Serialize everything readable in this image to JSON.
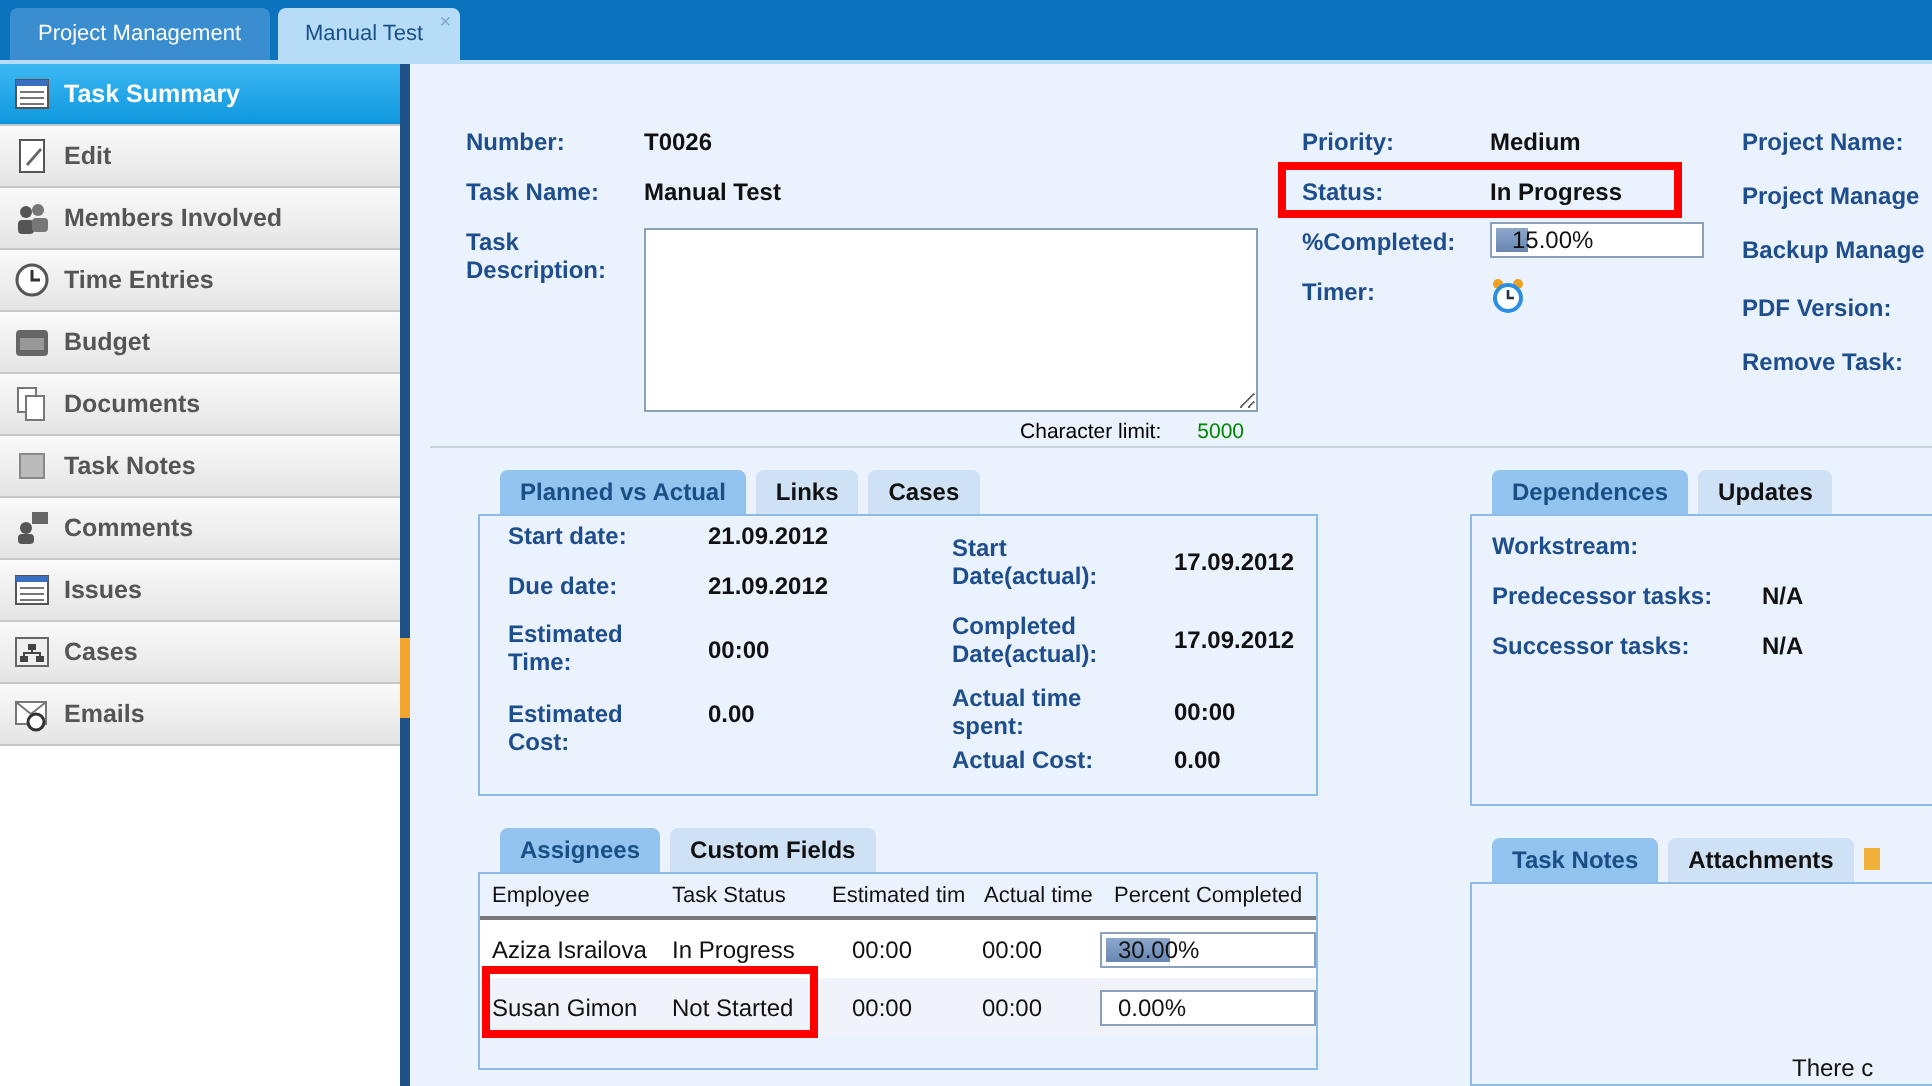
{
  "top_tabs": [
    {
      "label": "Project Management",
      "selected": false
    },
    {
      "label": "Manual Test",
      "selected": true,
      "close": "×"
    }
  ],
  "sidebar": {
    "items": [
      {
        "label": "Task Summary",
        "selected": true
      },
      {
        "label": "Edit",
        "selected": false
      },
      {
        "label": "Members Involved",
        "selected": false
      },
      {
        "label": "Time Entries",
        "selected": false
      },
      {
        "label": "Budget",
        "selected": false
      },
      {
        "label": "Documents",
        "selected": false
      },
      {
        "label": "Task Notes",
        "selected": false
      },
      {
        "label": "Comments",
        "selected": false
      },
      {
        "label": "Issues",
        "selected": false
      },
      {
        "label": "Cases",
        "selected": false
      },
      {
        "label": "Emails",
        "selected": false
      }
    ]
  },
  "summary": {
    "number_label": "Number:",
    "number": "T0026",
    "name_label": "Task Name:",
    "name": "Manual Test",
    "description_label": "Task Description:",
    "char_limit_label": "Character limit:",
    "char_limit": "5000",
    "priority_label": "Priority:",
    "priority": "Medium",
    "status_label": "Status:",
    "status": "In Progress",
    "status_highlighted": true,
    "completed_label": "%Completed:",
    "completed": {
      "value": "15.00%",
      "level": 0.15
    },
    "timer_label": "Timer:",
    "right_labels": [
      "Project Name:",
      "Project Manage",
      "Backup Manage",
      "PDF Version:",
      "Remove Task:"
    ]
  },
  "planned": {
    "tabs": [
      {
        "label": "Planned vs Actual",
        "selected": true
      },
      {
        "label": "Links",
        "selected": false
      },
      {
        "label": "Cases",
        "selected": false
      }
    ],
    "left": [
      {
        "label": "Start date:",
        "value": "21.09.2012"
      },
      {
        "label": "Due date:",
        "value": "21.09.2012"
      },
      {
        "label": "Estimated Time:",
        "value": "00:00"
      },
      {
        "label": "Estimated Cost:",
        "value": "0.00"
      }
    ],
    "right": [
      {
        "label": "Start Date(actual):",
        "value": "17.09.2012"
      },
      {
        "label": "Completed Date(actual):",
        "value": "17.09.2012"
      },
      {
        "label": "Actual time spent:",
        "value": "00:00"
      },
      {
        "label": "Actual Cost:",
        "value": "0.00"
      }
    ]
  },
  "dependences": {
    "tabs": [
      {
        "label": "Dependences",
        "selected": true
      },
      {
        "label": "Updates",
        "selected": false
      }
    ],
    "rows": [
      {
        "label": "Workstream:",
        "value": ""
      },
      {
        "label": "Predecessor tasks:",
        "value": "N/A"
      },
      {
        "label": "Successor tasks:",
        "value": "N/A"
      }
    ]
  },
  "assignees": {
    "tabs": [
      {
        "label": "Assignees",
        "selected": true
      },
      {
        "label": "Custom Fields",
        "selected": false
      }
    ],
    "columns": [
      "Employee",
      "Task Status",
      "Estimated tim",
      "Actual time",
      "Percent Completed"
    ],
    "rows": [
      {
        "employee": "Aziza Israilova",
        "status": "In Progress",
        "estimated": "00:00",
        "actual": "00:00",
        "percent": "30.00%",
        "level": 0.3,
        "highlighted": false
      },
      {
        "employee": "Susan Gimon",
        "status": "Not Started",
        "estimated": "00:00",
        "actual": "00:00",
        "percent": "0.00%",
        "highlighted": true
      }
    ]
  },
  "notes": {
    "tabs": [
      {
        "label": "Task Notes",
        "selected": true
      },
      {
        "label": "Attachments",
        "selected": false
      }
    ],
    "message": "There c"
  }
}
